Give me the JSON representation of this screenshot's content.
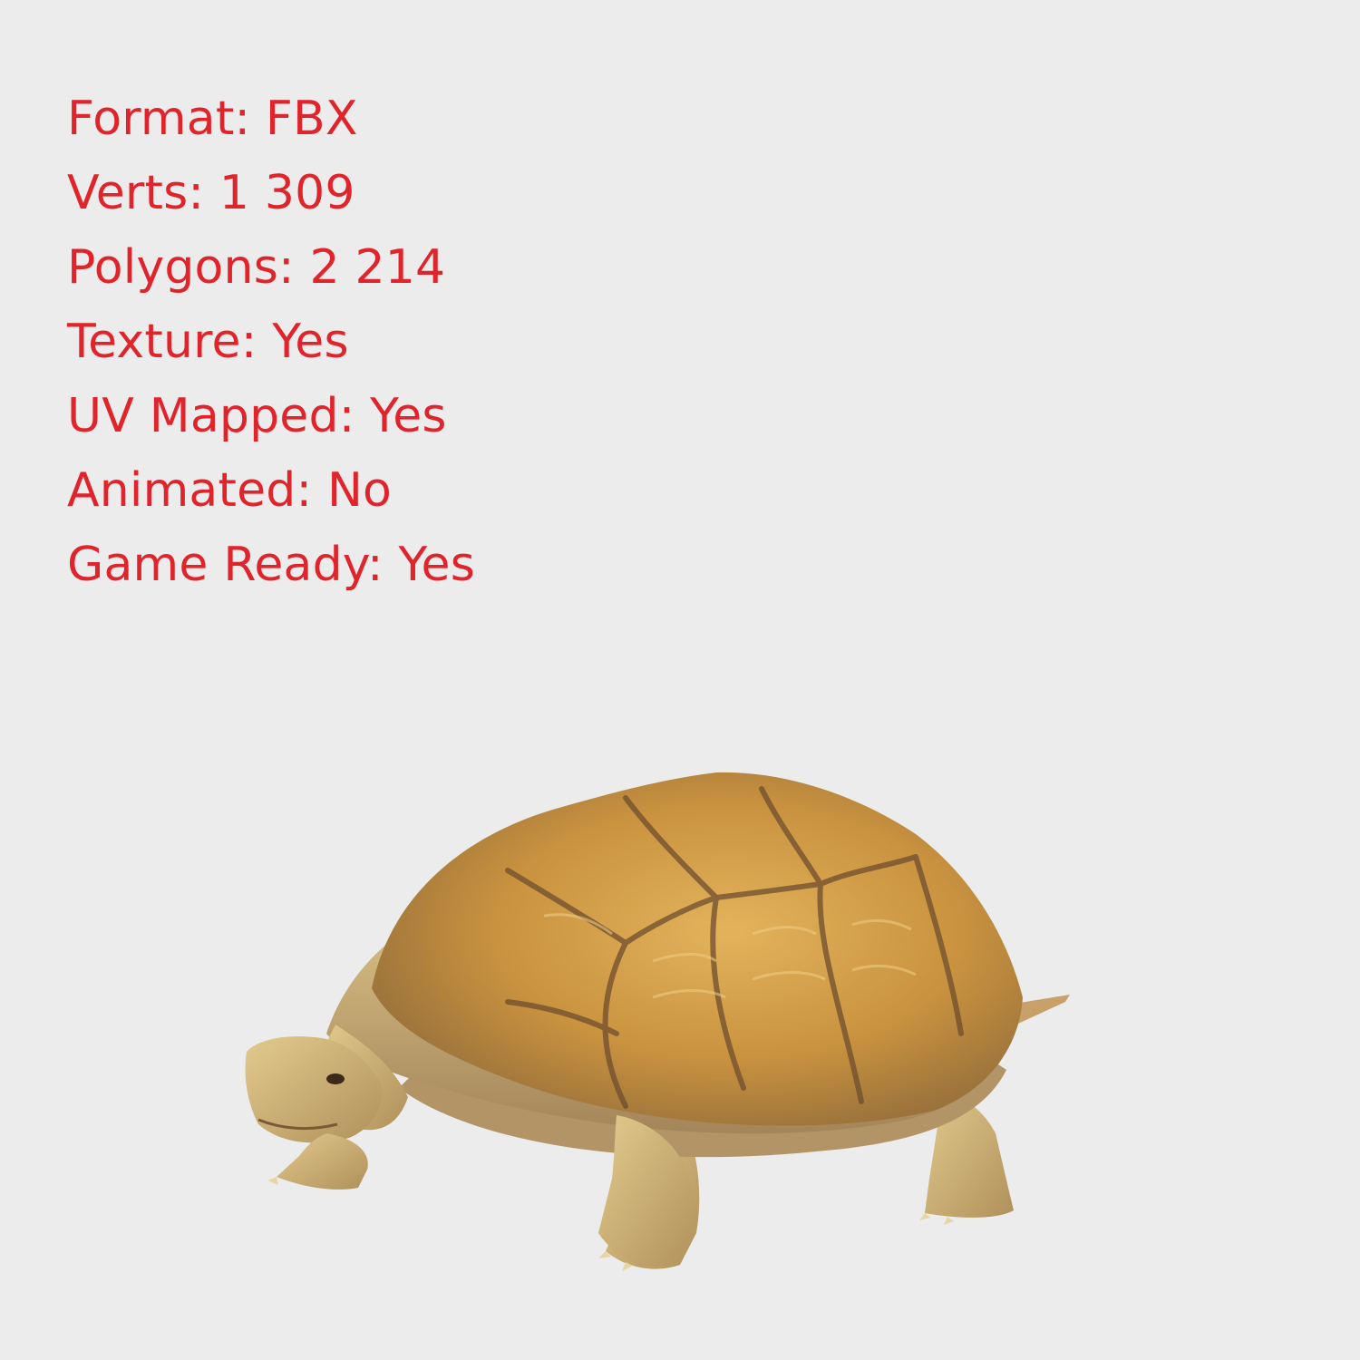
{
  "specs": [
    {
      "label": "Format",
      "value": "FBX"
    },
    {
      "label": "Verts",
      "value": "1 309"
    },
    {
      "label": "Polygons",
      "value": "2 214"
    },
    {
      "label": "Texture",
      "value": "Yes"
    },
    {
      "label": "UV Mapped",
      "value": "Yes"
    },
    {
      "label": "Animated",
      "value": "No"
    },
    {
      "label": "Game Ready",
      "value": "Yes"
    }
  ],
  "colors": {
    "background": "#ececec",
    "spec_text": "#e0242b",
    "shell": "#c9923f",
    "skin": "#d2b47a"
  },
  "model_preview": {
    "subject": "tortoise-3d-model"
  }
}
